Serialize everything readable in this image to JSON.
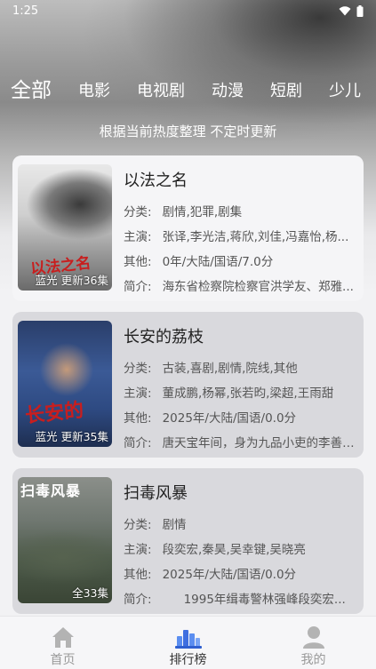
{
  "status": {
    "time": "1:25"
  },
  "tabs": [
    "全部",
    "电影",
    "电视剧",
    "动漫",
    "短剧",
    "少儿"
  ],
  "subtitle": "根据当前热度整理 不定时更新",
  "labels": {
    "genre": "分类:",
    "cast": "主演:",
    "other": "其他:",
    "intro": "简介:"
  },
  "items": [
    {
      "title": "以法之名",
      "badge": "蓝光 更新36集",
      "genre": "剧情,犯罪,剧集",
      "cast": "张译,李光洁,蒋欣,刘佳,冯嘉怡,杨...",
      "other": "0年/大陆/国语/7.0分",
      "intro": "海东省检察院检察官洪学友、郑雅...",
      "art": "以法之名"
    },
    {
      "title": "长安的荔枝",
      "badge": "蓝光 更新35集",
      "genre": "古装,喜剧,剧情,院线,其他",
      "cast": "董成鹏,杨幂,张若昀,梁超,王雨甜",
      "other": "2025年/大陆/国语/0.0分",
      "intro": "唐天宝年间，身为九品小吏的李善德骂...",
      "art": "长安的"
    },
    {
      "title": "扫毒风暴",
      "badge": "全33集",
      "genre": "剧情",
      "cast": "段奕宏,秦昊,吴幸键,吴晓亮",
      "other": "2025年/大陆/国语/0.0分",
      "intro": "1995年缉毒警林强峰段奕宏...",
      "art": "扫毒风暴"
    }
  ],
  "nav": [
    {
      "label": "首页",
      "icon": "home-icon"
    },
    {
      "label": "排行榜",
      "icon": "ranking-icon"
    },
    {
      "label": "我的",
      "icon": "user-icon"
    }
  ]
}
